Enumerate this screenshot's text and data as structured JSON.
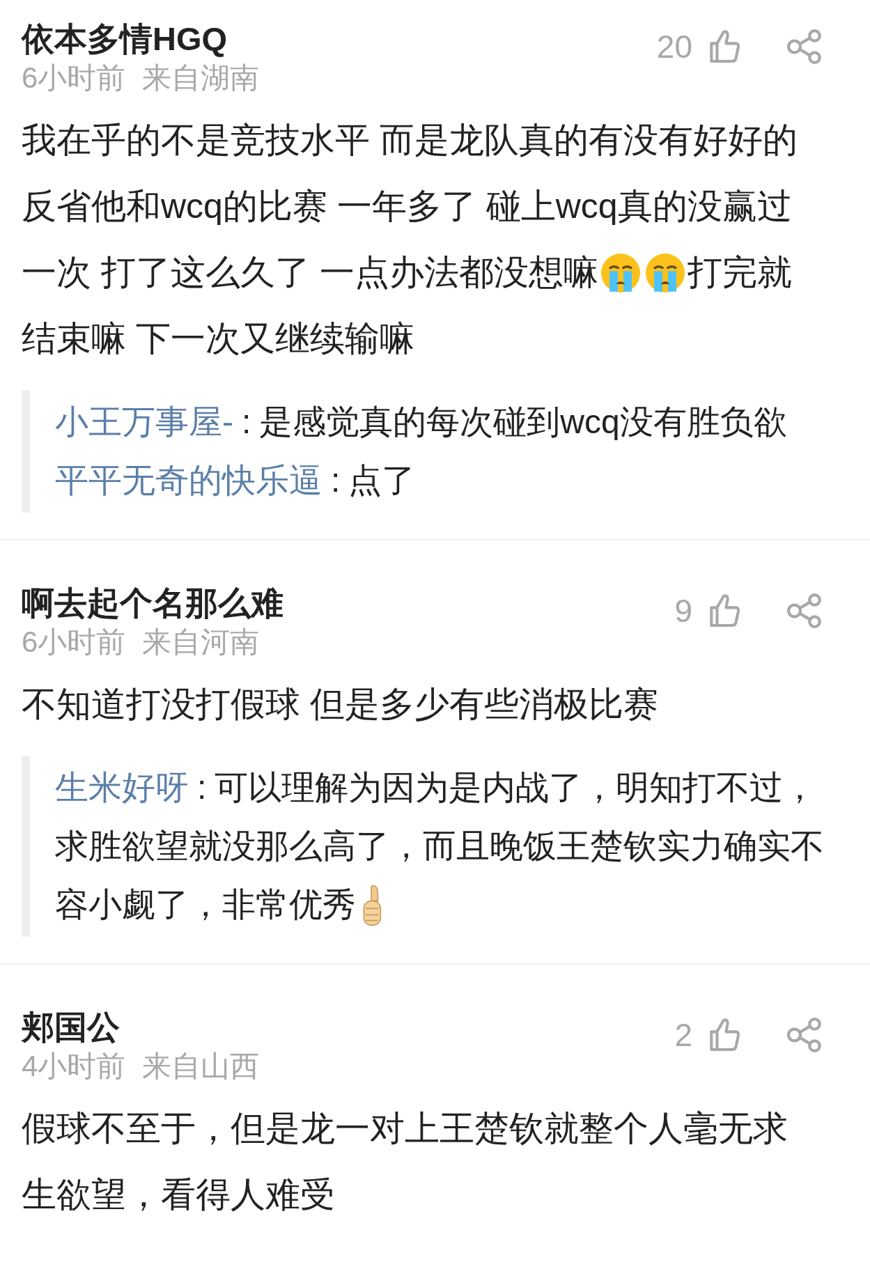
{
  "comments": [
    {
      "username": "依本多情HGQ",
      "time": "6小时前",
      "location": "来自湖南",
      "likes": "20",
      "lines": [
        [
          {
            "kind": "text",
            "text": "我在乎的不是竞技水平 而是龙队真的有没有好好的"
          }
        ],
        [
          {
            "kind": "text",
            "text": "反省他和wcq的比赛 一年多了 碰上wcq真的没赢过"
          }
        ],
        [
          {
            "kind": "text",
            "text": "一次 打了这么久了 一点办法都没想嘛"
          },
          {
            "kind": "crying_emoji"
          },
          {
            "kind": "crying_emoji"
          },
          {
            "kind": "text",
            "text": "打完就"
          }
        ],
        [
          {
            "kind": "text",
            "text": "结束嘛 下一次又继续输嘛"
          }
        ]
      ],
      "replies": [
        {
          "user": "小王万事屋-",
          "separator": ":",
          "lines": [
            [
              {
                "kind": "text",
                "text": "是感觉真的每次碰到wcq没有胜负欲"
              }
            ]
          ]
        },
        {
          "user": "平平无奇的快乐逼",
          "separator": ":",
          "lines": [
            [
              {
                "kind": "text",
                "text": "点了"
              }
            ]
          ]
        }
      ]
    },
    {
      "username": "啊去起个名那么难",
      "time": "6小时前",
      "location": "来自河南",
      "likes": "9",
      "lines": [
        [
          {
            "kind": "text",
            "text": "不知道打没打假球 但是多少有些消极比赛"
          }
        ]
      ],
      "replies": [
        {
          "user": "生米好呀",
          "separator": ":",
          "lines": [
            [
              {
                "kind": "text",
                "text": "可以理解为因为是内战了，明知打不过，"
              }
            ],
            [
              {
                "kind": "text",
                "text": "求胜欲望就没那么高了，而且晚饭王楚钦实力确实不"
              }
            ],
            [
              {
                "kind": "text",
                "text": "容小觑了，非常优秀"
              },
              {
                "kind": "thumbs_up_emoji"
              }
            ]
          ]
        }
      ]
    },
    {
      "username": "郏国公",
      "time": "4小时前",
      "location": "来自山西",
      "likes": "2",
      "lines": [
        [
          {
            "kind": "text",
            "text": "假球不至于，但是龙一对上王楚钦就整个人毫无求"
          }
        ],
        [
          {
            "kind": "text",
            "text": "生欲望，看得人难受"
          }
        ]
      ]
    }
  ]
}
